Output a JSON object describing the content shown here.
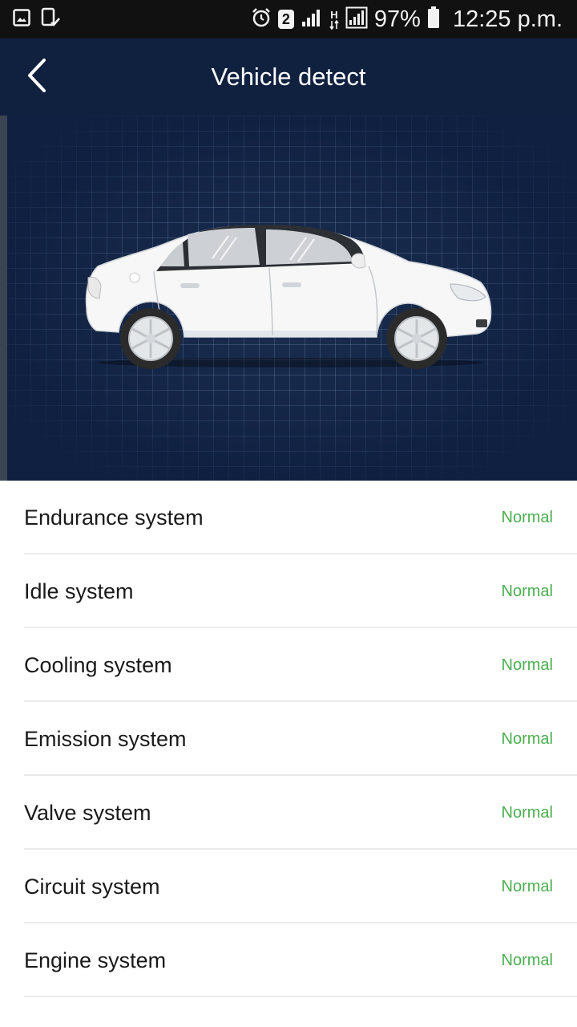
{
  "status_bar": {
    "battery": "97%",
    "time": "12:25 p.m.",
    "sim_slot": "2",
    "network_type": "H",
    "icons_left": [
      "image-icon",
      "phone-check-icon"
    ],
    "icons_right": [
      "alarm-icon",
      "sim-2-icon",
      "signal-icon",
      "network-h-icon",
      "signal-icon",
      "battery-icon"
    ]
  },
  "header": {
    "title": "Vehicle detect",
    "back_icon": "chevron-left-icon"
  },
  "hero": {
    "image": "car-illustration",
    "colors": {
      "background": "#0f2040",
      "grid": "#7896be"
    }
  },
  "systems": [
    {
      "label": "Endurance system",
      "status": "Normal"
    },
    {
      "label": "Idle system",
      "status": "Normal"
    },
    {
      "label": "Cooling system",
      "status": "Normal"
    },
    {
      "label": "Emission system",
      "status": "Normal"
    },
    {
      "label": "Valve system",
      "status": "Normal"
    },
    {
      "label": "Circuit system",
      "status": "Normal"
    },
    {
      "label": "Engine system",
      "status": "Normal"
    }
  ],
  "colors": {
    "header": "#102140",
    "status_ok": "#4caf50",
    "status_bar": "#111111"
  }
}
